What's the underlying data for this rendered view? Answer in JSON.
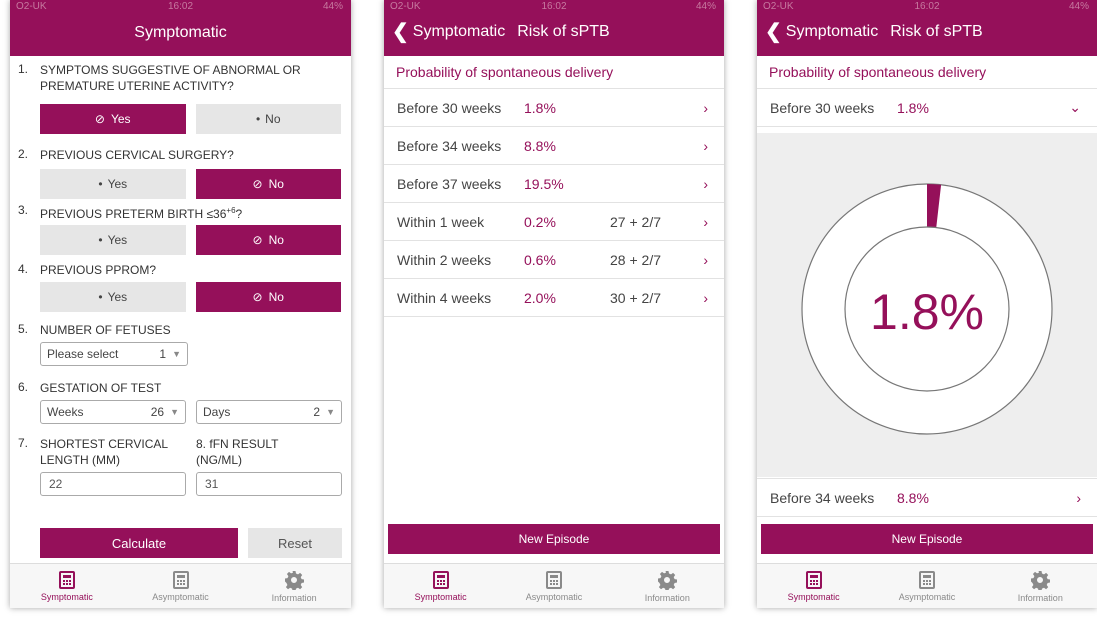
{
  "status": {
    "carrier": "O2-UK",
    "time": "16:02",
    "battery": "44%"
  },
  "tabs": [
    {
      "label": "Symptomatic"
    },
    {
      "label": "Asymptomatic"
    },
    {
      "label": "Information"
    }
  ],
  "screen1": {
    "title": "Symptomatic",
    "q1": {
      "num": "1.",
      "text": "SYMPTOMS SUGGESTIVE OF ABNORMAL OR PREMATURE UTERINE ACTIVITY?",
      "yes": "Yes",
      "no": "No",
      "selected": "yes"
    },
    "q2": {
      "num": "2.",
      "text": "PREVIOUS CERVICAL SURGERY?",
      "yes": "Yes",
      "no": "No",
      "selected": "no"
    },
    "q3": {
      "num": "3.",
      "text": "PREVIOUS PRETERM BIRTH ≤36",
      "sup": "+6",
      "suffix": "?",
      "yes": "Yes",
      "no": "No",
      "selected": "no"
    },
    "q4": {
      "num": "4.",
      "text": "PREVIOUS PPROM?",
      "yes": "Yes",
      "no": "No",
      "selected": "no"
    },
    "q5": {
      "num": "5.",
      "text": "NUMBER OF FETUSES",
      "placeholder": "Please select",
      "value": "1"
    },
    "q6": {
      "num": "6.",
      "text": "GESTATION OF TEST",
      "weeks_label": "Weeks",
      "weeks_value": "26",
      "days_label": "Days",
      "days_value": "2"
    },
    "q7": {
      "num": "7.",
      "text": "SHORTEST CERVICAL LENGTH (MM)",
      "value": "22"
    },
    "q8": {
      "num": "8.",
      "text": "fFN RESULT (NG/ML)",
      "value": "31"
    },
    "calculate": "Calculate",
    "reset": "Reset"
  },
  "screen2": {
    "back": "Symptomatic",
    "title": "Risk of sPTB",
    "section": "Probability of spontaneous delivery",
    "rows": [
      {
        "label": "Before 30 weeks",
        "pct": "1.8%",
        "ga": ""
      },
      {
        "label": "Before 34 weeks",
        "pct": "8.8%",
        "ga": ""
      },
      {
        "label": "Before 37 weeks",
        "pct": "19.5%",
        "ga": ""
      },
      {
        "label": "Within 1 week",
        "pct": "0.2%",
        "ga": "27 + 2/7"
      },
      {
        "label": "Within 2 weeks",
        "pct": "0.6%",
        "ga": "28 + 2/7"
      },
      {
        "label": "Within 4 weeks",
        "pct": "2.0%",
        "ga": "30 + 2/7"
      }
    ],
    "new_episode": "New Episode"
  },
  "screen3": {
    "back": "Symptomatic",
    "title": "Risk of sPTB",
    "section": "Probability of spontaneous delivery",
    "expanded": {
      "label": "Before 30 weeks",
      "pct": "1.8%"
    },
    "gauge": {
      "value_label": "1.8%",
      "fraction": 0.018,
      "color": "#95105a"
    },
    "next": {
      "label": "Before 34 weeks",
      "pct": "8.8%"
    },
    "new_episode": "New Episode"
  },
  "colors": {
    "brand": "#95105a",
    "button_off": "#e6e6e6"
  }
}
